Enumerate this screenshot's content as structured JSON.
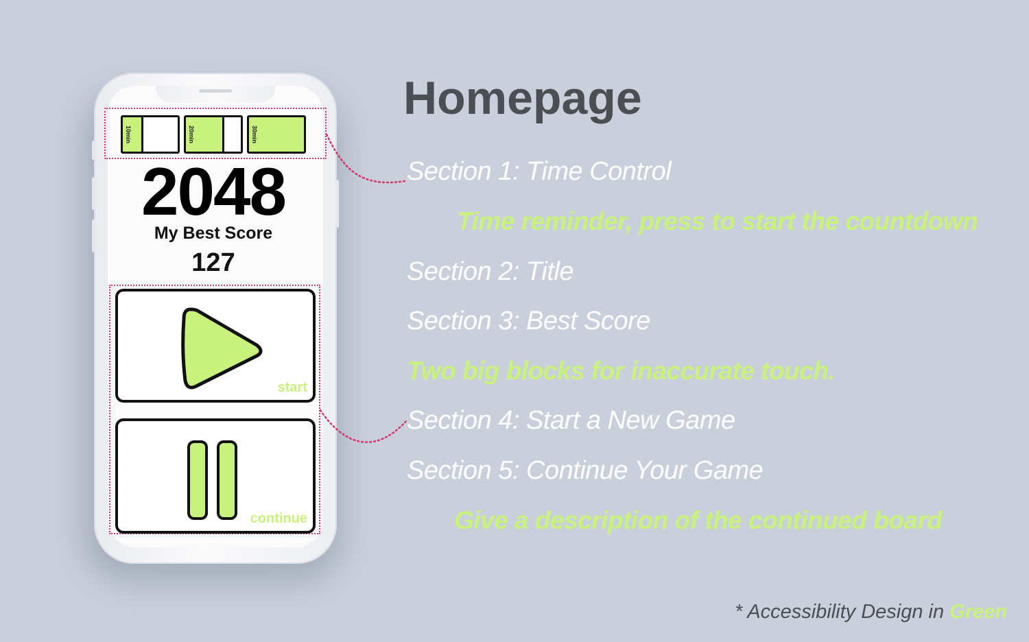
{
  "app": {
    "title": "2048",
    "best_score_label": "My Best Score",
    "best_score_value": "127",
    "timers": [
      {
        "label": "10min",
        "fill_fraction": 0.35
      },
      {
        "label": "20min",
        "fill_fraction": 0.7
      },
      {
        "label": "30min",
        "fill_fraction": 1.0
      }
    ],
    "start_label": "start",
    "continue_label": "continue"
  },
  "annotations": {
    "heading": "Homepage",
    "section1": "Section 1: Time Control",
    "note1": "Time reminder, press to start the countdown",
    "section2": "Section 2: Title",
    "section3": "Section 3: Best Score",
    "note2": "Two big blocks for inaccurate touch.",
    "section4": "Section 4: Start a New Game",
    "section5": "Section 5: Continue Your Game",
    "note3": "Give a description of the continued board",
    "footer_prefix": "* Accessibility Design in ",
    "footer_highlight": "Green"
  },
  "colors": {
    "background": "#c9d0dc",
    "accent_green": "#c9f27c",
    "dotted_outline": "#d6336c",
    "heading_gray": "#4b4e53"
  },
  "icons": [
    "play-icon",
    "pause-icon"
  ]
}
